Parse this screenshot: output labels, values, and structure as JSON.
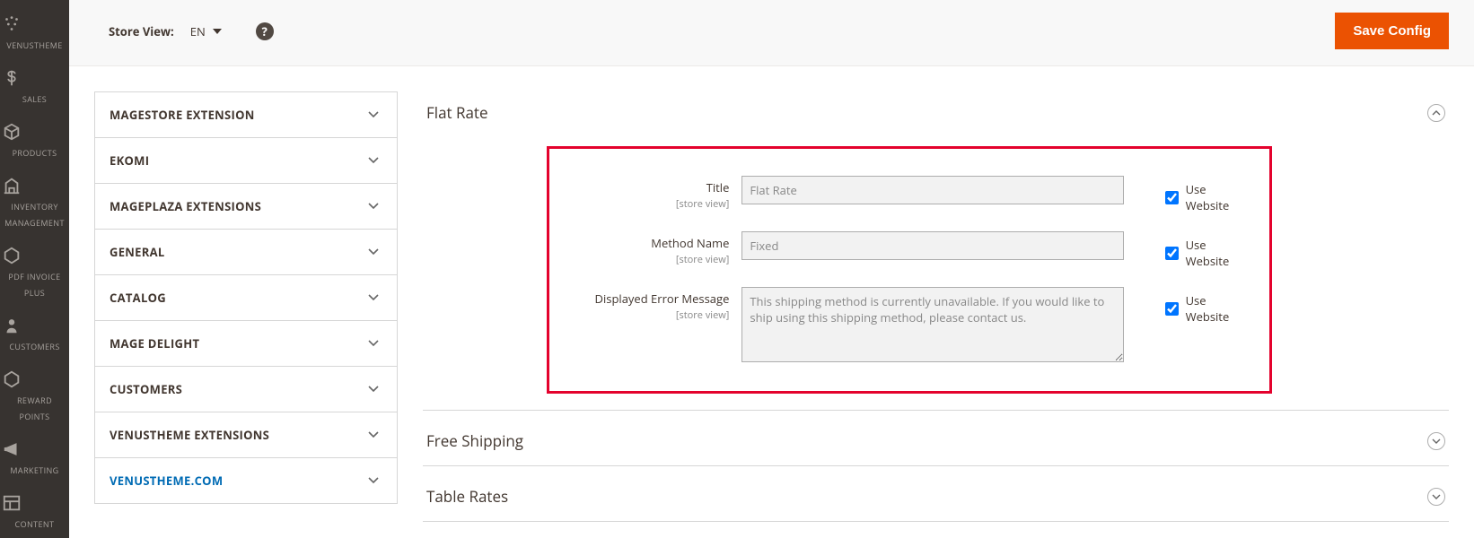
{
  "topbar": {
    "store_view_label": "Store View:",
    "store_view_value": "EN",
    "save_label": "Save Config"
  },
  "nav": {
    "items": [
      {
        "id": "venustheme",
        "label": "VENUSTHEME"
      },
      {
        "id": "sales",
        "label": "SALES"
      },
      {
        "id": "products",
        "label": "PRODUCTS"
      },
      {
        "id": "inventory",
        "label": "INVENTORY\nMANAGEMENT"
      },
      {
        "id": "pdfinvoice",
        "label": "PDF INVOICE\nPLUS"
      },
      {
        "id": "customers",
        "label": "CUSTOMERS"
      },
      {
        "id": "reward",
        "label": "REWARD\nPOINTS"
      },
      {
        "id": "marketing",
        "label": "MARKETING"
      },
      {
        "id": "content",
        "label": "CONTENT"
      }
    ]
  },
  "tabs": {
    "items": [
      {
        "label": "MAGESTORE EXTENSION"
      },
      {
        "label": "EKOMI"
      },
      {
        "label": "MAGEPLAZA EXTENSIONS"
      },
      {
        "label": "GENERAL"
      },
      {
        "label": "CATALOG"
      },
      {
        "label": "MAGE DELIGHT"
      },
      {
        "label": "CUSTOMERS"
      },
      {
        "label": "VENUSTHEME EXTENSIONS"
      },
      {
        "label": "VENUSTHEME.COM",
        "active": true
      }
    ]
  },
  "sections": {
    "flat_rate": {
      "title": "Flat Rate",
      "fields": {
        "title": {
          "label": "Title",
          "scope": "[store view]",
          "value": "Flat Rate",
          "use_website": true,
          "use_website_label": "Use Website"
        },
        "method": {
          "label": "Method Name",
          "scope": "[store view]",
          "value": "Fixed",
          "use_website": true,
          "use_website_label": "Use Website"
        },
        "error": {
          "label": "Displayed Error Message",
          "scope": "[store view]",
          "value": "This shipping method is currently unavailable. If you would like to ship using this shipping method, please contact us.",
          "use_website": true,
          "use_website_label": "Use Website"
        }
      }
    },
    "free_shipping": {
      "title": "Free Shipping"
    },
    "table_rates": {
      "title": "Table Rates"
    }
  }
}
